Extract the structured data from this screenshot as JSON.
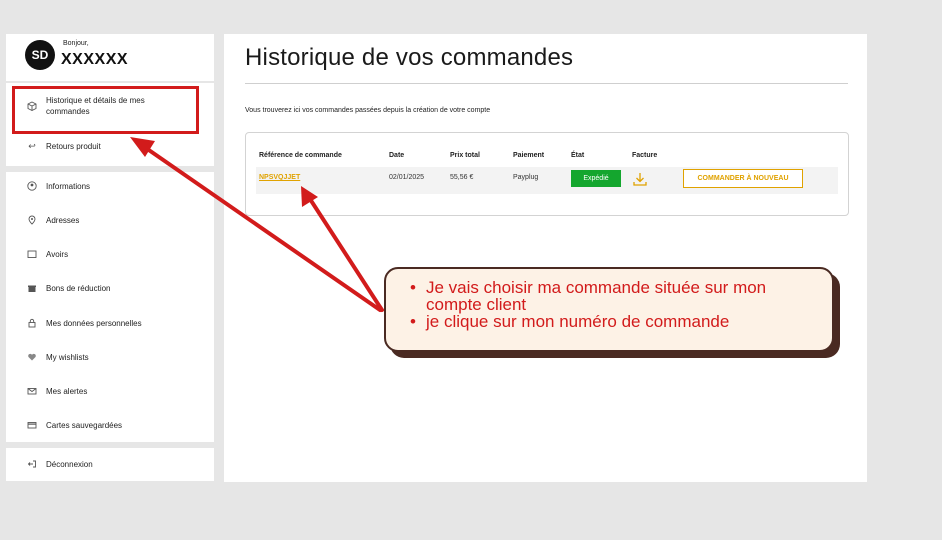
{
  "user": {
    "initials": "SD",
    "greeting": "Bonjour,",
    "name": "XXXXXX"
  },
  "sidebar": {
    "items": [
      {
        "label": "Historique et détails de mes commandes",
        "icon": "box-icon"
      },
      {
        "label": "Retours produit",
        "icon": "return-arrow-icon"
      },
      {
        "label": "Informations",
        "icon": "user-circle-icon"
      },
      {
        "label": "Adresses",
        "icon": "location-pin-icon"
      },
      {
        "label": "Avoirs",
        "icon": "credit-note-icon"
      },
      {
        "label": "Bons de réduction",
        "icon": "voucher-icon"
      },
      {
        "label": "Mes données personnelles",
        "icon": "lock-icon"
      },
      {
        "label": "My wishlists",
        "icon": "heart-icon"
      },
      {
        "label": "Mes alertes",
        "icon": "mail-icon"
      },
      {
        "label": "Cartes sauvegardées",
        "icon": "card-icon"
      }
    ],
    "logout": {
      "label": "Déconnexion",
      "icon": "logout-icon"
    }
  },
  "main": {
    "title": "Historique de vos commandes",
    "intro": "Vous trouverez ici vos commandes passées depuis la création de votre compte",
    "table": {
      "headers": [
        "Référence de commande",
        "Date",
        "Prix total",
        "Paiement",
        "État",
        "Facture"
      ],
      "rows": [
        {
          "reference": "NPSVQJJET",
          "date": "02/01/2025",
          "total": "55,56 €",
          "payment": "Payplug",
          "status": "Expédié",
          "reorder": "COMMANDER À NOUVEAU"
        }
      ]
    }
  },
  "callout": {
    "lines": [
      "Je vais choisir ma commande située sur mon compte client",
      "je clique sur mon numéro de commande"
    ]
  },
  "colors": {
    "accent": "#e0a200",
    "status_green": "#14a62e",
    "annotation_red": "#d21b1b",
    "callout_bg": "#fdf2e6",
    "callout_border": "#4a2a22"
  }
}
